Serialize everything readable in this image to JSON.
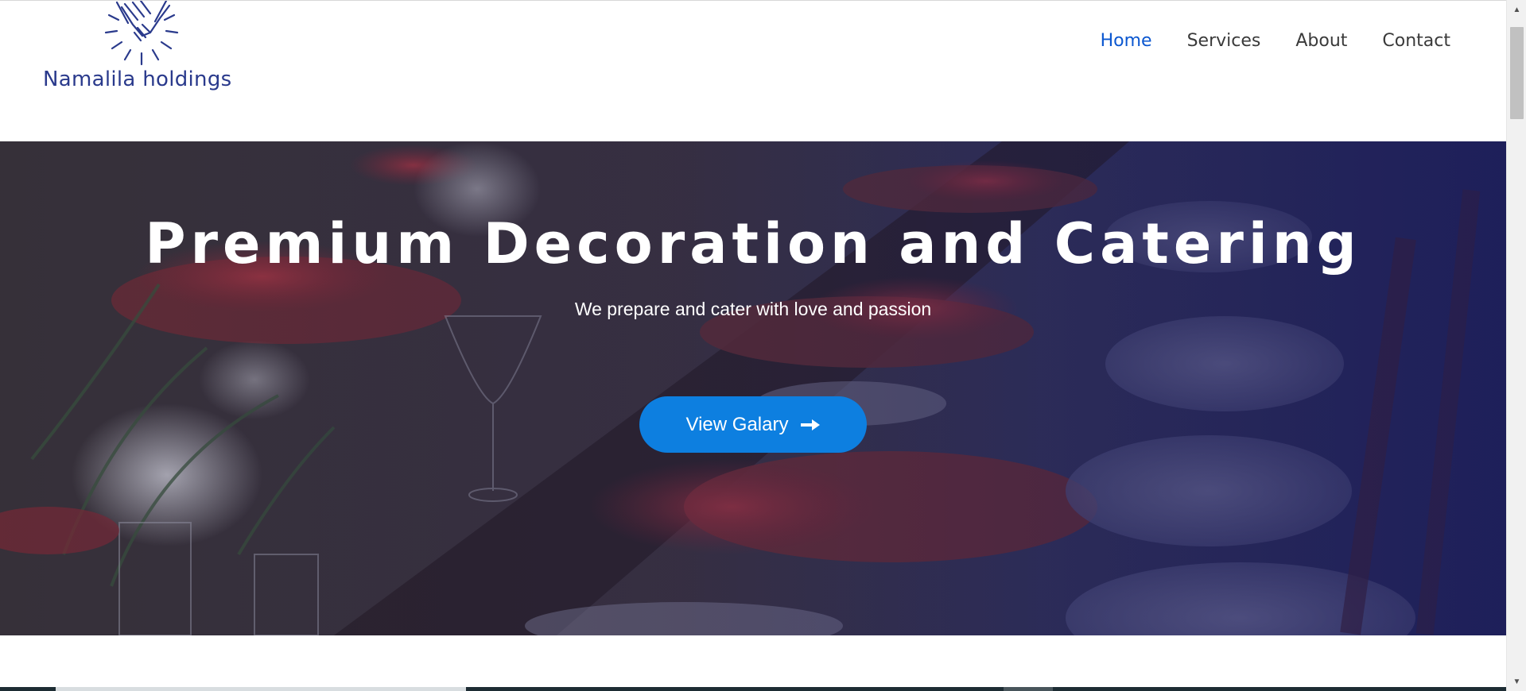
{
  "logo": {
    "text": "Namalila holdings",
    "icon": "handshake-icon",
    "color": "#2a3a8c"
  },
  "nav": {
    "items": [
      {
        "label": "Home",
        "active": true
      },
      {
        "label": "Services",
        "active": false
      },
      {
        "label": "About",
        "active": false
      },
      {
        "label": "Contact",
        "active": false
      }
    ],
    "active_color": "#0b57d0"
  },
  "hero": {
    "title": "Premium Decoration and Catering",
    "subtitle": "We prepare and cater with love and passion",
    "button_label": "View Galary",
    "button_icon": "arrow-right-icon",
    "button_color": "#0d7fe0",
    "background": "table-setting-photo"
  }
}
